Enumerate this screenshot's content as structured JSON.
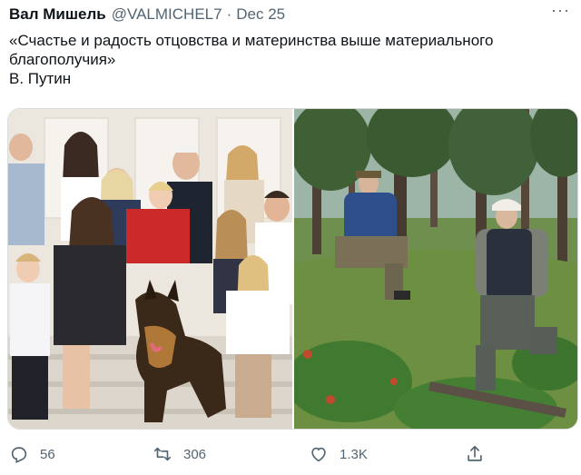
{
  "tweet": {
    "author_name": "Вал Мишель",
    "handle": "@VALMICHEL7",
    "separator": "·",
    "date": "Dec 25",
    "more_label": "···",
    "text_quote": "«Счастье и радость отцовства и материнства выше материального благополучия»",
    "text_signature": "В. Путин"
  },
  "media": {
    "left_photo": "family-portrait-photo",
    "right_photo": "forest-hillside-photo"
  },
  "actions": {
    "reply_count": "56",
    "retweet_count": "306",
    "like_count": "1.3K"
  },
  "colors": {
    "text": "#0f1419",
    "muted": "#536471",
    "border": "#d8dde1"
  }
}
